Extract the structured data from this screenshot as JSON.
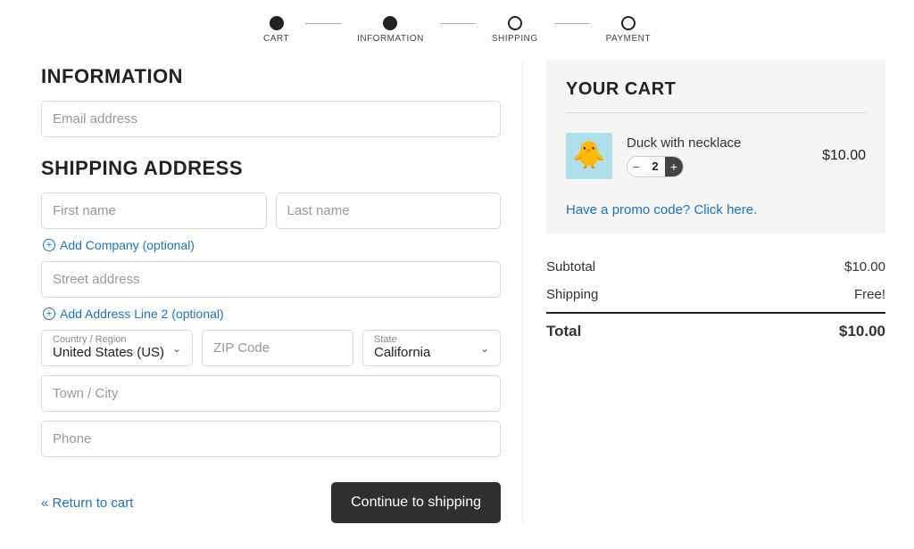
{
  "stepper": {
    "steps": [
      {
        "label": "CART",
        "filled": true
      },
      {
        "label": "INFORMATION",
        "filled": true
      },
      {
        "label": "SHIPPING",
        "filled": false
      },
      {
        "label": "PAYMENT",
        "filled": false
      }
    ]
  },
  "information": {
    "heading": "INFORMATION",
    "email_placeholder": "Email address"
  },
  "shipping": {
    "heading": "SHIPPING ADDRESS",
    "first_name_placeholder": "First name",
    "last_name_placeholder": "Last name",
    "add_company_label": "Add Company (optional)",
    "street_placeholder": "Street address",
    "add_line2_label": "Add Address Line 2 (optional)",
    "country_label": "Country / Region",
    "country_value": "United States (US)",
    "zip_placeholder": "ZIP Code",
    "state_label": "State",
    "state_value": "California",
    "town_placeholder": "Town / City",
    "phone_placeholder": "Phone"
  },
  "actions": {
    "return_label": "« Return to cart",
    "continue_label": "Continue to shipping"
  },
  "cart": {
    "heading": "YOUR CART",
    "item": {
      "name": "Duck with necklace",
      "quantity": "2",
      "price": "$10.00"
    },
    "promo_label": "Have a promo code? Click here.",
    "subtotal_label": "Subtotal",
    "subtotal_value": "$10.00",
    "shipping_label": "Shipping",
    "shipping_value": "Free!",
    "total_label": "Total",
    "total_value": "$10.00"
  }
}
